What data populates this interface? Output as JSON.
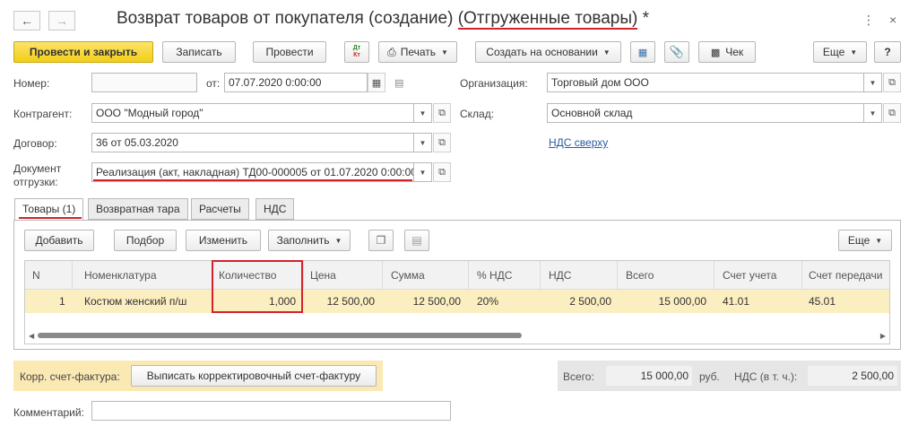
{
  "window": {
    "title_prefix": "Возврат товаров от покупателя (создание) ",
    "title_highlight": "(Отгруженные товары)",
    "title_suffix": " *"
  },
  "toolbar": {
    "post_close": "Провести и закрыть",
    "save": "Записать",
    "post": "Провести",
    "dt_kt_top": "Дт",
    "dt_kt_bottom": "Кт",
    "print": "Печать",
    "create_based": "Создать на основании",
    "check": "Чек",
    "more": "Еще",
    "help": "?"
  },
  "form": {
    "number_label": "Номер:",
    "number_value": "",
    "date_label": "от:",
    "date_value": "07.07.2020  0:00:00",
    "org_label": "Организация:",
    "org_value": "Торговый дом ООО",
    "counterparty_label": "Контрагент:",
    "counterparty_value": "ООО \"Модный город\"",
    "warehouse_label": "Склад:",
    "warehouse_value": "Основной склад",
    "contract_label": "Договор:",
    "contract_value": "36 от 05.03.2020",
    "vat_link": "НДС сверху",
    "shipment_label_1": "Документ",
    "shipment_label_2": "отгрузки:",
    "shipment_value": "Реализация (акт, накладная) ТД00-000005 от 01.07.2020 0:00:00"
  },
  "tabs": [
    {
      "label": "Товары (1)"
    },
    {
      "label": "Возвратная тара"
    },
    {
      "label": "Расчеты"
    },
    {
      "label": "НДС"
    }
  ],
  "table_toolbar": {
    "add": "Добавить",
    "pick": "Подбор",
    "change": "Изменить",
    "fill": "Заполнить",
    "more": "Еще"
  },
  "table": {
    "columns": [
      "N",
      "Номенклатура",
      "Количество",
      "Цена",
      "Сумма",
      "% НДС",
      "НДС",
      "Всего",
      "Счет учета",
      "Счет передачи"
    ],
    "rows": [
      [
        "1",
        "Костюм женский п/ш",
        "1,000",
        "12 500,00",
        "12 500,00",
        "20%",
        "2 500,00",
        "15 000,00",
        "41.01",
        "45.01"
      ]
    ]
  },
  "footer": {
    "corr_label": "Корр. счет-фактура:",
    "corr_button": "Выписать корректировочный счет-фактуру",
    "total_label": "Всего:",
    "total_value": "15 000,00",
    "currency": "руб.",
    "vat_label": "НДС (в т. ч.):",
    "vat_value": "2 500,00",
    "comment_label": "Комментарий:",
    "comment_value": ""
  },
  "colors": {
    "accent_underline": "#d2232a",
    "primary_button": "#f3cd18",
    "selected_row": "#fbeec0",
    "link": "#2c5aa0"
  }
}
